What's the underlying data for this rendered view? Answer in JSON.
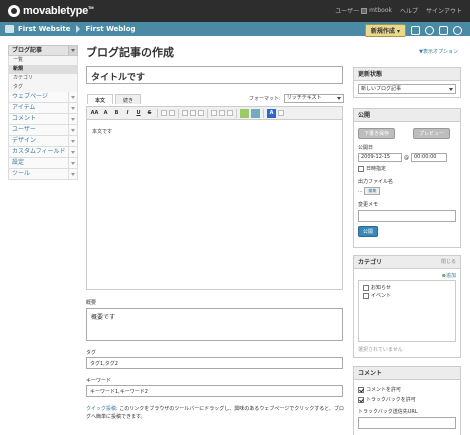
{
  "header": {
    "logo_text": "movabletype",
    "user_prefix": "ユーザー",
    "user_name": "mtbook",
    "help": "ヘルプ",
    "signout": "サインアウト"
  },
  "nav": {
    "site": "First Website",
    "blog": "First Weblog",
    "new_button": "新規作成"
  },
  "sidebar": {
    "head": "ブログ記事",
    "sub_items": [
      "一覧",
      "新規",
      "カテゴリ",
      "タグ"
    ],
    "active_index": 1,
    "items": [
      "ウェブページ",
      "アイテム",
      "コメント",
      "ユーザー",
      "デザイン",
      "カスタムフィールド",
      "設定",
      "ツール"
    ]
  },
  "main": {
    "page_title": "ブログ記事の作成",
    "display_options": "▼表示オプション",
    "title_value": "タイトルです",
    "tabs": [
      "本文",
      "続き"
    ],
    "format_label": "フォーマット:",
    "format_value": "リッチテキスト",
    "toolbar": [
      "AA",
      "A",
      "B",
      "I",
      "U",
      "S"
    ],
    "body_text": "本文です",
    "excerpt_label": "概要",
    "excerpt_value": "概要です",
    "tags_label": "タグ",
    "tags_value": "タグ1,タグ2",
    "keywords_label": "キーワード",
    "keywords_value": "キーワード1,キーワード2",
    "help_link": "クイック投稿",
    "help_text": ": このリンクをブラウザのツールバーにドラッグし、興味のあるウェブページでクリックすると、ブログへ簡単に投稿できます。"
  },
  "widgets": {
    "status": {
      "head": "更新状態",
      "value": "新しいブログ記事"
    },
    "publish": {
      "head": "公開",
      "save_draft": "下書き保存",
      "preview": "プレビュー",
      "date_label": "公開日",
      "date": "2009-12-15",
      "at": "@",
      "time": "00:00:00",
      "schedule_label": "日時指定",
      "output_label": "出力ファイル名",
      "output_value": "...",
      "edit_button": "編集",
      "memo_label": "変更メモ",
      "publish_button": "公開"
    },
    "category": {
      "head": "カテゴリ",
      "close": "閉じる",
      "add": "追加",
      "items": [
        "お知らせ",
        "イベント"
      ],
      "none_selected": "選択されていません"
    },
    "comments": {
      "head": "コメント",
      "allow_comments": "コメントを許可",
      "allow_trackbacks": "トラックバックを許可",
      "trackback_url_label": "トラックバック送信先URL"
    }
  },
  "colors": {
    "header_bg": "#2d2d2d",
    "nav_bg": "#4a8aa5",
    "link": "#3a7a99",
    "new_button_bg": "#e9d98f"
  }
}
